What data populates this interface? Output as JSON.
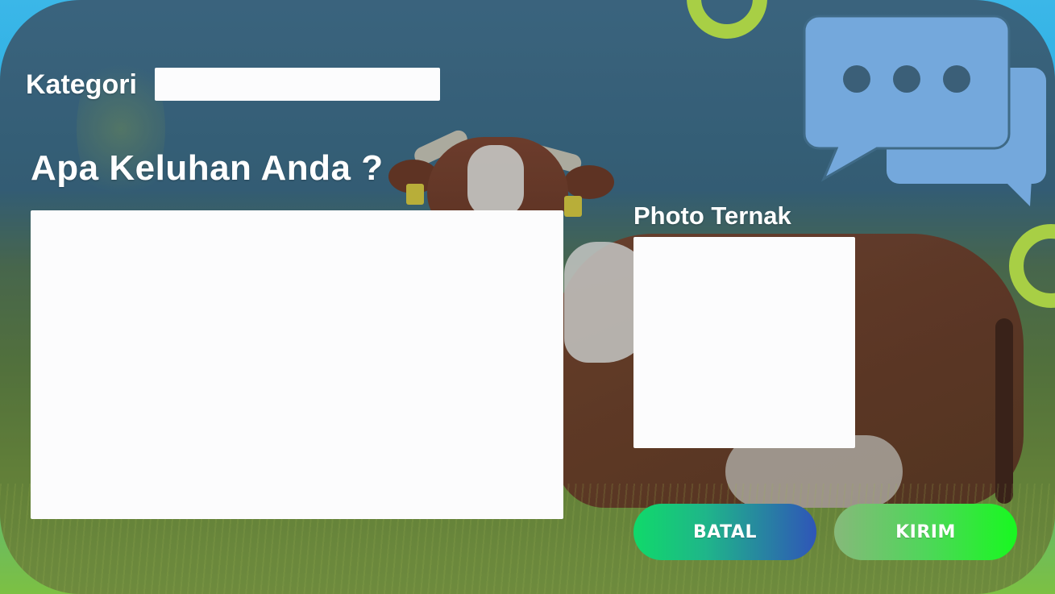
{
  "form": {
    "kategori_label": "Kategori",
    "kategori_value": "",
    "keluhan_label": "Apa Keluhan Anda ?",
    "keluhan_value": "",
    "photo_label": "Photo Ternak"
  },
  "buttons": {
    "cancel_label": "BATAL",
    "submit_label": "KIRIM"
  },
  "icons": {
    "chat": "chat-bubbles-icon"
  },
  "colors": {
    "accent_ring": "#a8cf45",
    "chat_icon": "#74a8dc",
    "cancel_gradient_start": "#10d96a",
    "cancel_gradient_end": "#2f55b8",
    "submit_gradient_start": "#86b97a",
    "submit_gradient_end": "#18f820"
  }
}
